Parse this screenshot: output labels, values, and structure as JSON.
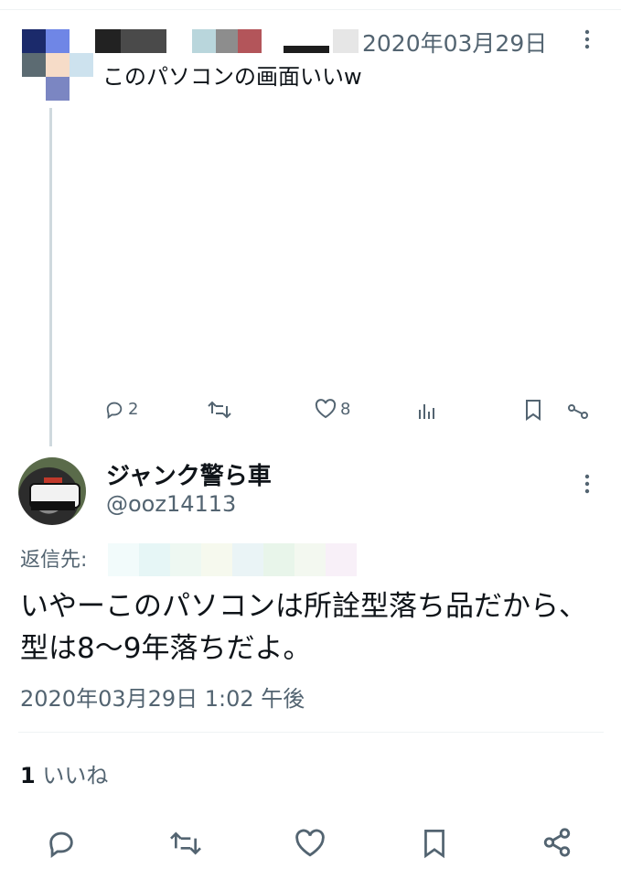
{
  "quoted_tweet": {
    "timestamp": "2020年03月29日",
    "text": "このパソコンの画面いいw",
    "stats": {
      "replies": "2",
      "likes": "8"
    }
  },
  "reply_tweet": {
    "display_name": "ジャンク警ら車",
    "handle": "@ooz14113",
    "reply_to_label": "返信先:",
    "text": "いやーこのパソコンは所詮型落ち品だから、型は8〜9年落ちだよ。",
    "timestamp": "2020年03月29日 1:02 午後",
    "like_count": "1",
    "like_label": "いいね"
  },
  "colors": {
    "text": "#0f1419",
    "muted": "#536471",
    "divider": "#eff3f4"
  },
  "icons": {
    "top_actions": [
      "reply-icon",
      "retweet-icon",
      "like-icon",
      "views-icon",
      "bookmark-icon",
      "share-icon"
    ],
    "bottom_actions": [
      "reply-icon",
      "retweet-icon",
      "like-icon",
      "bookmark-icon",
      "share-icon"
    ],
    "more": "more-icon"
  }
}
